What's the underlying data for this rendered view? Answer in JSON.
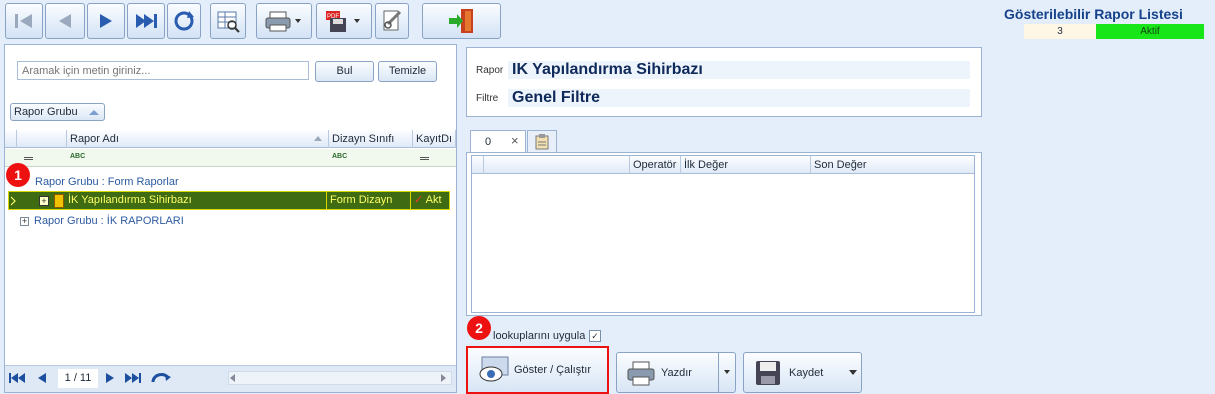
{
  "header": {
    "title": "Gösterilebilir Rapor Listesi",
    "count": "3",
    "status": "Aktif"
  },
  "toolbar": {
    "icons": [
      "first-icon",
      "prev-icon",
      "next-icon",
      "last-icon",
      "refresh-icon",
      "grid-preview-icon",
      "print-icon",
      "pdf-save-icon",
      "report-design-icon",
      "exit-icon"
    ]
  },
  "search": {
    "placeholder": "Aramak için metin giriniz...",
    "find_label": "Bul",
    "clear_label": "Temizle"
  },
  "grid": {
    "group_chip": "Rapor Grubu",
    "columns": [
      "Rapor Adı",
      "Dizayn Sınıfı",
      "KayıtDı"
    ],
    "filter_abc": "ABC",
    "groups": [
      {
        "label": "Rapor Grubu : Form Raporlar"
      },
      {
        "label": "Rapor Grubu : İK RAPORLARI"
      }
    ],
    "rows": [
      {
        "name": "İK Yapılandırma Sihirbazı",
        "design": "Form Dizayn",
        "status": "Akt"
      }
    ],
    "pager": "1 / 11"
  },
  "report": {
    "label_rapor": "Rapor",
    "rapor_value": "IK Yapılandırma Sihirbazı",
    "label_filtre": "Filtre",
    "filtre_value": "Genel Filtre"
  },
  "filter_tabs": {
    "tab0": "0"
  },
  "filter_grid": {
    "columns": [
      "Operatör",
      "İlk Değer",
      "Son Değer"
    ]
  },
  "options": {
    "lookup_label": "lookuplarını uygula"
  },
  "actions": {
    "show": "Göster / Çalıştır",
    "print": "Yazdır",
    "save": "Kaydet"
  },
  "badges": {
    "b1": "1",
    "b2": "2"
  }
}
